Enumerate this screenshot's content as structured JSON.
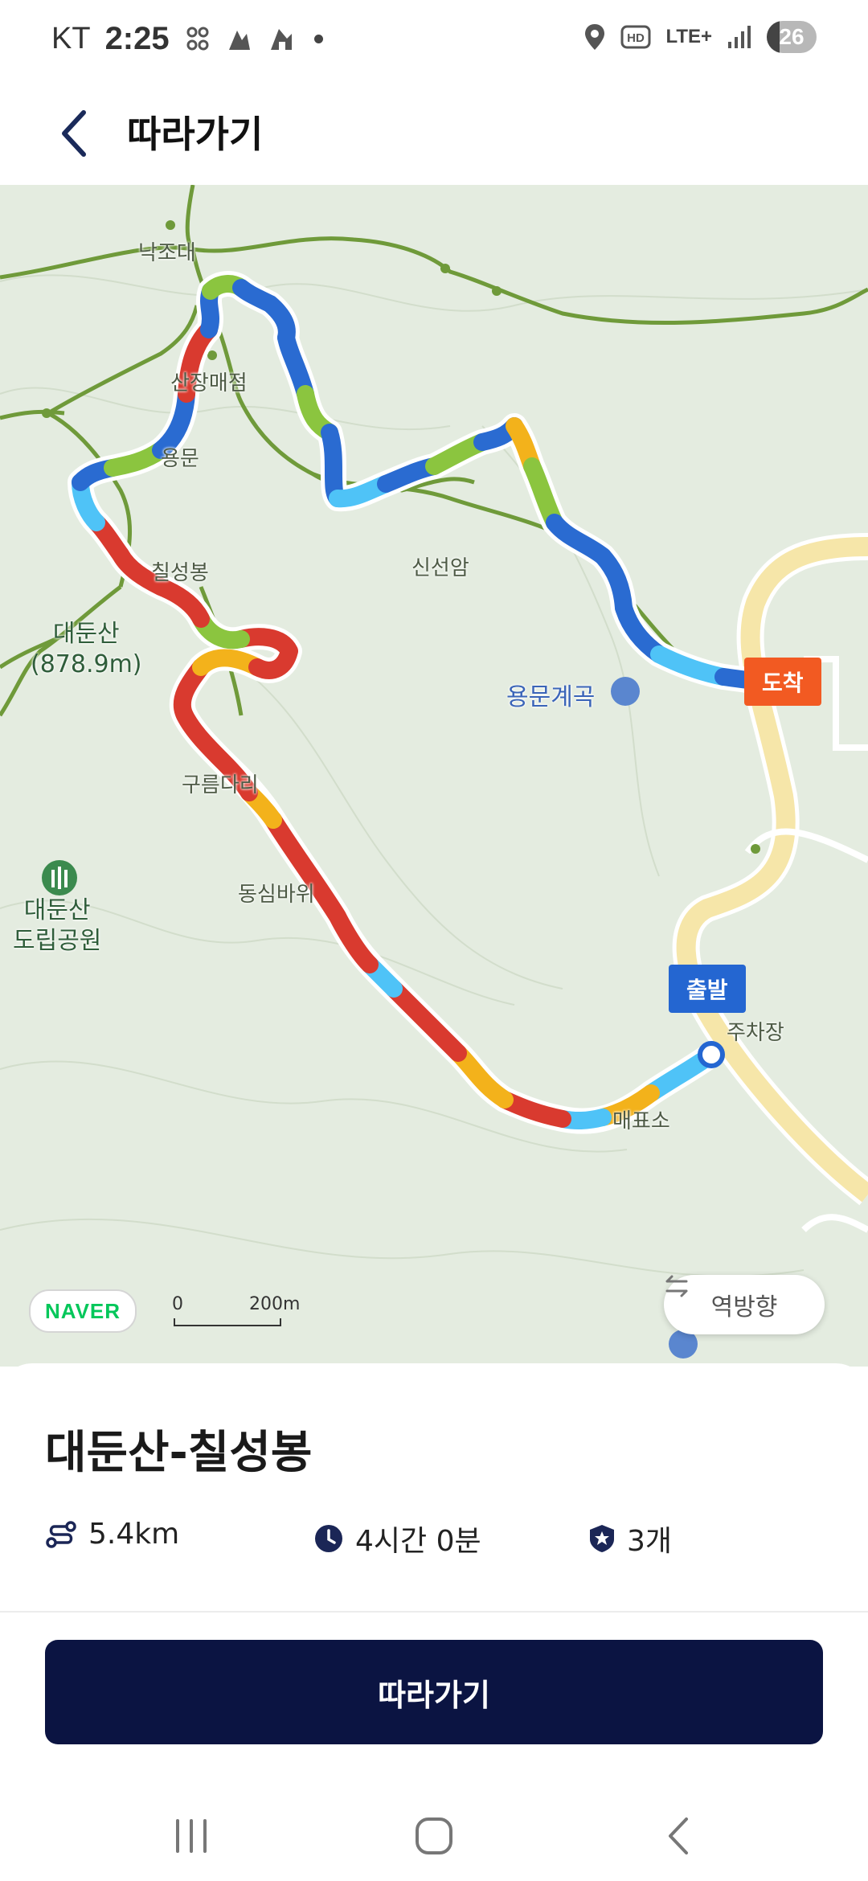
{
  "status_bar": {
    "carrier": "KT",
    "time": "2:25",
    "network": "LTE+",
    "battery": "26"
  },
  "header": {
    "back_icon": "chevron-left-icon",
    "title": "따라가기"
  },
  "map": {
    "labels": {
      "nakjodae": "낙조대",
      "sanjang": "산장매점",
      "yongmun": "용문",
      "chilsung": "칠성봉",
      "daedunsan": "대둔산",
      "daedunsan_height": "(878.9m)",
      "gureum": "구름다리",
      "park_line1": "대둔산",
      "park_line2": "도립공원",
      "dongsim": "동심바위",
      "seonam": "신선암",
      "yongmun_valley": "용문계곡",
      "parking": "주차장",
      "ticket": "매표소"
    },
    "marker_end": "도착",
    "marker_start": "출발",
    "naver": "NAVER",
    "scale_zero": "0",
    "scale_max": "200m",
    "reverse_label": "역방향"
  },
  "course": {
    "name": "대둔산-칠성봉",
    "distance": "5.4km",
    "duration": "4시간 0분",
    "checkpoints": "3개"
  },
  "action": {
    "follow_label": "따라가기"
  },
  "colors": {
    "primary": "#0b1442",
    "route_red": "#d93a2f",
    "route_blue": "#2a6bd1",
    "route_green": "#8bc53f",
    "route_orange": "#f3b21b",
    "route_cyan": "#4fc3f7"
  }
}
